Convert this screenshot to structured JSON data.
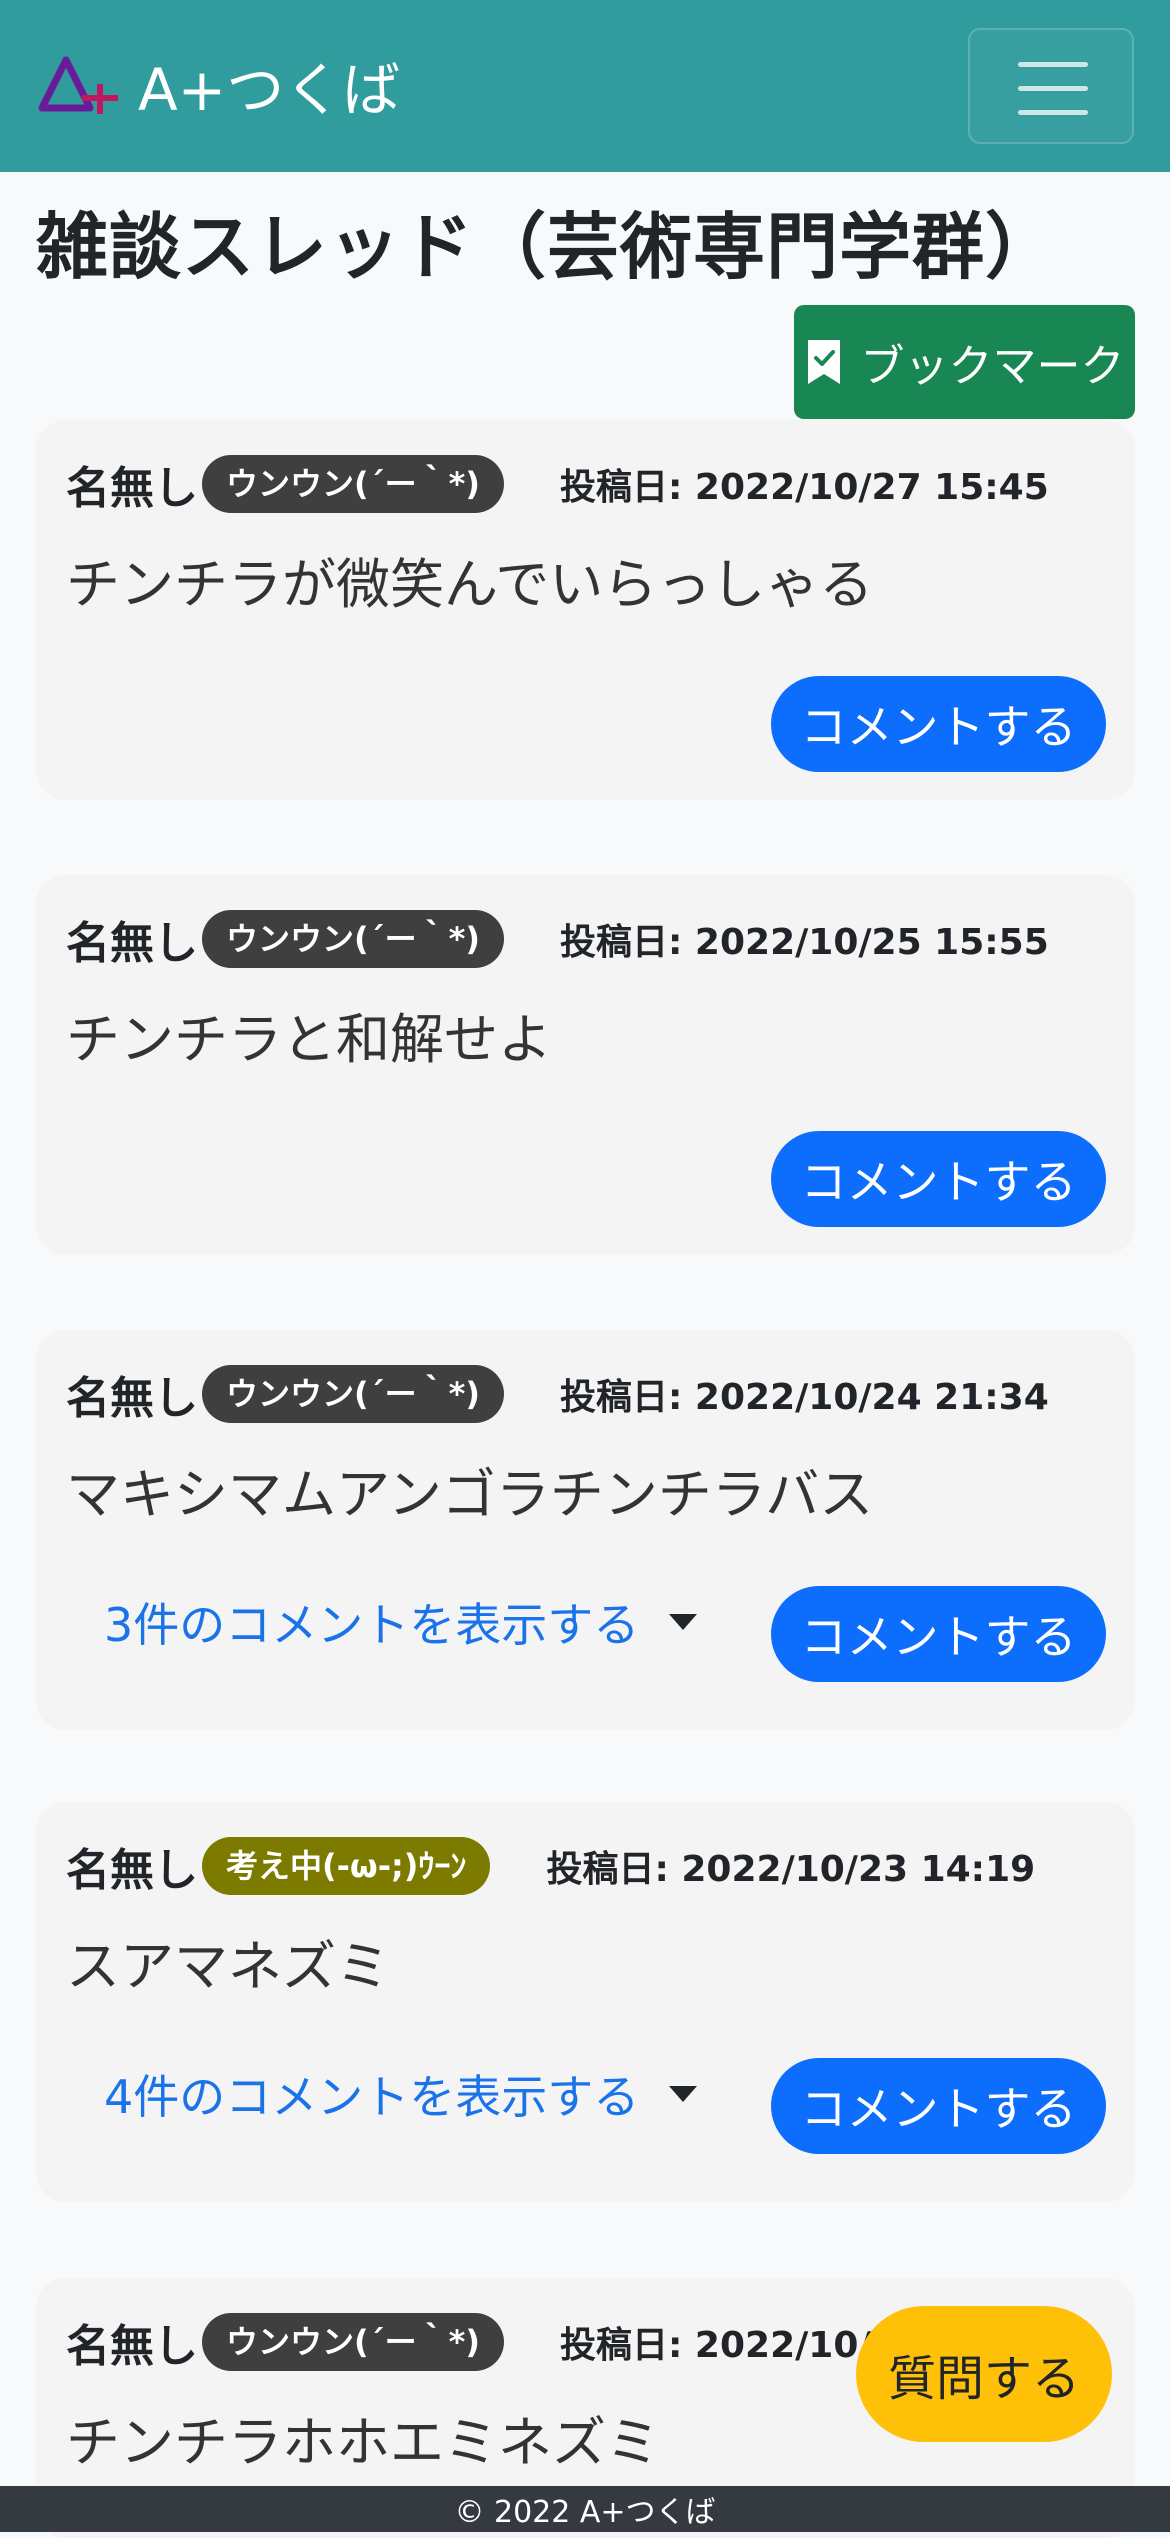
{
  "header": {
    "brand_text": "A+つくば",
    "brand_color_a": "#8a2be2",
    "brand_color_plus": "#c0185f"
  },
  "page": {
    "title": "雑談スレッド（芸術専門学群）",
    "bookmark_label": "ブックマーク"
  },
  "posts": [
    {
      "author": "名無し",
      "badge": "ウンウン(´ー｀*)",
      "badge_color": "#3f3f3f",
      "date": "投稿日: 2022/10/27 15:45",
      "text": "チンチラが微笑んでいらっしゃる",
      "comment_label": "コメントする",
      "show_comments": ""
    },
    {
      "author": "名無し",
      "badge": "ウンウン(´ー｀*)",
      "badge_color": "#3f3f3f",
      "date": "投稿日: 2022/10/25 15:55",
      "text": "チンチラと和解せよ",
      "comment_label": "コメントする",
      "show_comments": ""
    },
    {
      "author": "名無し",
      "badge": "ウンウン(´ー｀*)",
      "badge_color": "#3f3f3f",
      "date": "投稿日: 2022/10/24 21:34",
      "text": "マキシマムアンゴラチンチラバス",
      "comment_label": "コメントする",
      "show_comments": "3件のコメントを表示する"
    },
    {
      "author": "名無し",
      "badge": "考え中(-ω-;)ｳｰﾝ",
      "badge_color": "#7d7a00",
      "date": "投稿日: 2022/10/23 14:19",
      "text": "スアマネズミ",
      "comment_label": "コメントする",
      "show_comments": "4件のコメントを表示する"
    },
    {
      "author": "名無し",
      "badge": "ウンウン(´ー｀*)",
      "badge_color": "#3f3f3f",
      "date": "投稿日: 2022/10/20 13",
      "text": "チンチラホホエミネズミ",
      "comment_label": "",
      "show_comments": ""
    }
  ],
  "fab": {
    "ask_label": "質問する"
  },
  "footer": {
    "text": "© 2022 A+つくば"
  }
}
